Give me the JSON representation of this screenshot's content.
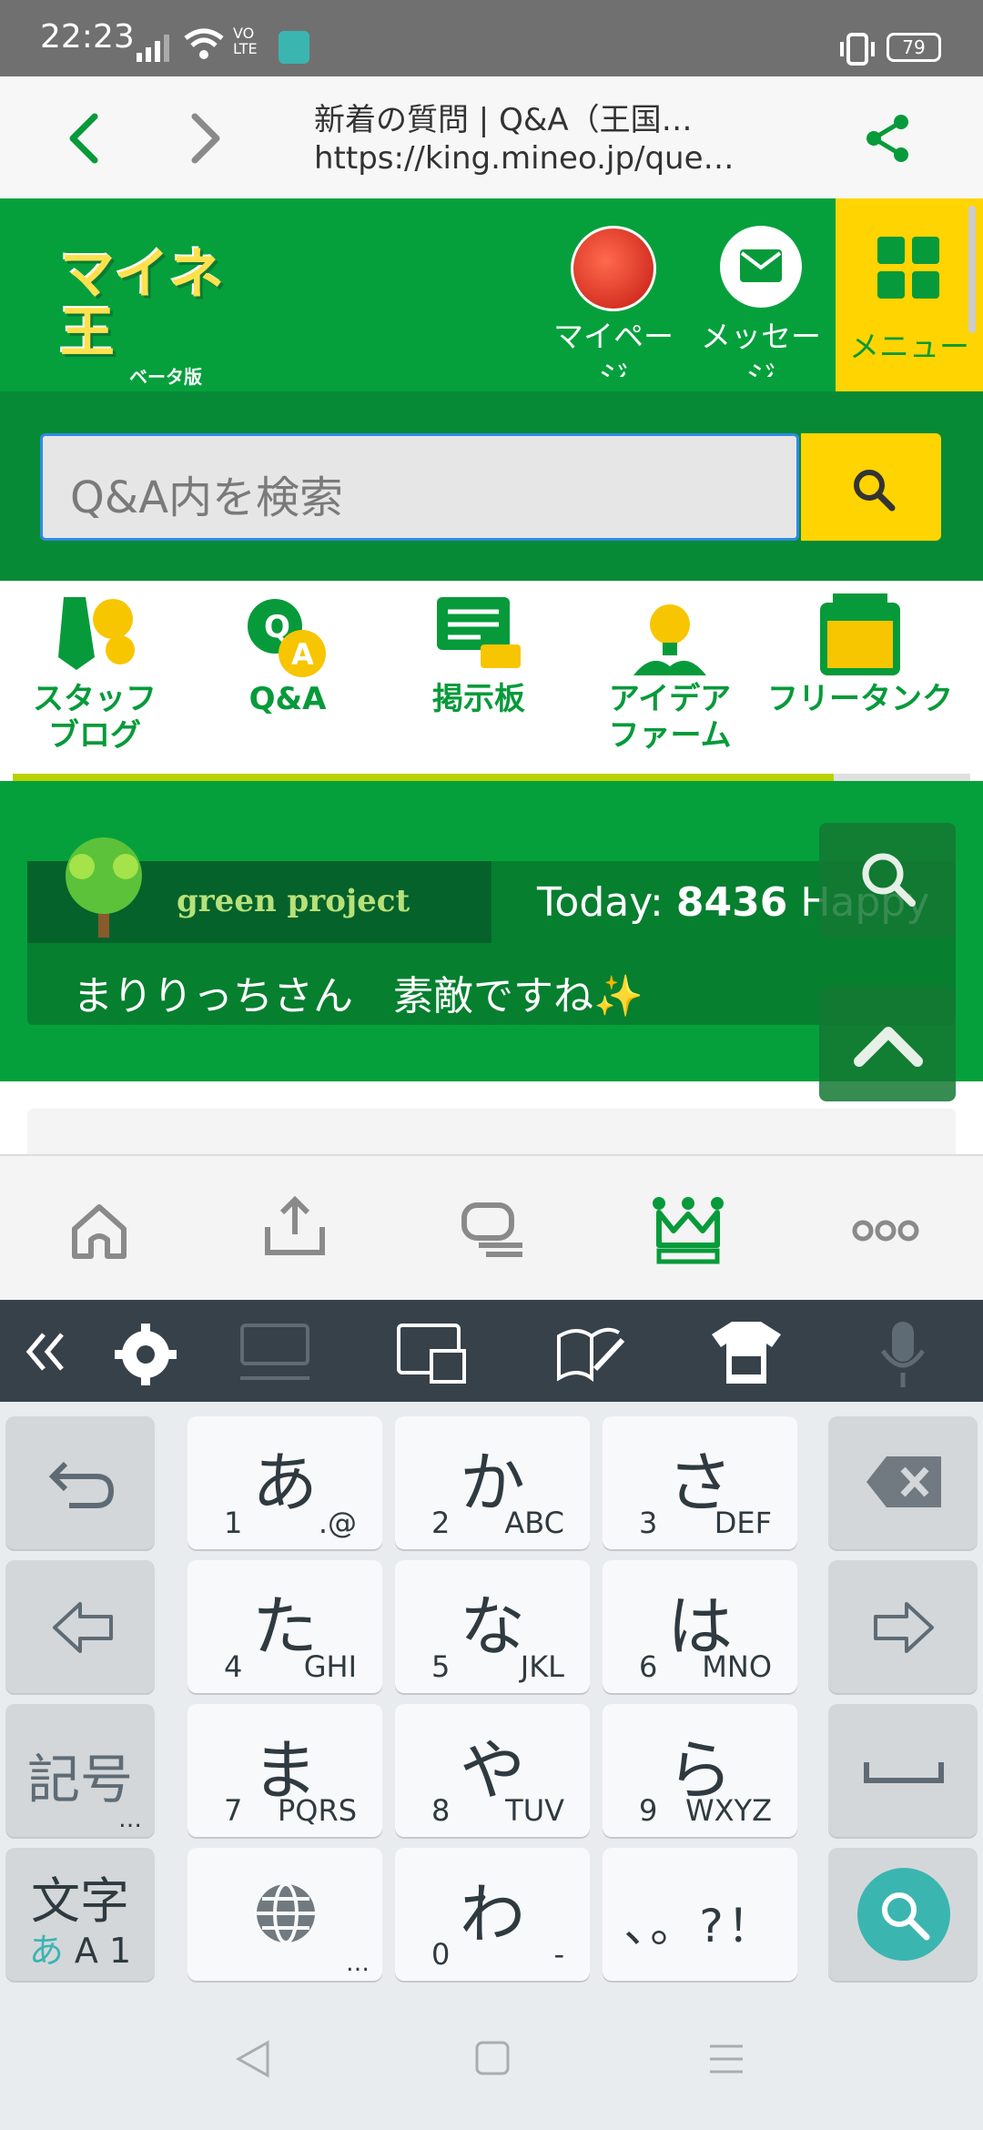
{
  "status_bar": {
    "time": "22:23",
    "battery": "79",
    "network_labels": "VO LTE"
  },
  "browser": {
    "page_title": "新着の質問 | Q&A（王国…",
    "url": "https://king.mineo.jp/que…"
  },
  "site_header": {
    "logo_text": "マイネ王",
    "logo_sub": "ベータ版",
    "mypage_label": "マイペー\nジ",
    "message_label": "メッセー\nジ",
    "menu_label": "メニュー"
  },
  "search": {
    "placeholder": "Q&A内を検索"
  },
  "categories": [
    {
      "label": "スタッフ\nブログ"
    },
    {
      "label": "Q&A"
    },
    {
      "label": "掲示板"
    },
    {
      "label": "アイデア\nファーム"
    },
    {
      "label": "フリータンク"
    }
  ],
  "green_project": {
    "logo_text": "green project",
    "today_prefix": "Today: ",
    "today_count": "8436",
    "today_suffix": " Happy",
    "message": "まりりっちさん　素敵ですね✨"
  },
  "keyboard": {
    "rows": [
      [
        {
          "big": "あ",
          "num": "1",
          "sub": ".@"
        },
        {
          "big": "か",
          "num": "2",
          "sub": "ABC"
        },
        {
          "big": "さ",
          "num": "3",
          "sub": "DEF"
        }
      ],
      [
        {
          "big": "た",
          "num": "4",
          "sub": "GHI"
        },
        {
          "big": "な",
          "num": "5",
          "sub": "JKL"
        },
        {
          "big": "は",
          "num": "6",
          "sub": "MNO"
        }
      ],
      [
        {
          "big": "ま",
          "num": "7",
          "sub": "PQRS"
        },
        {
          "big": "や",
          "num": "8",
          "sub": "TUV"
        },
        {
          "big": "ら",
          "num": "9",
          "sub": "WXYZ"
        }
      ]
    ],
    "symbol_key": "記号",
    "symbol_dots": "…",
    "mode_key_top": "文字",
    "mode_key_bottom_a": "あ",
    "mode_key_bottom_b": "A 1",
    "wa_key": "わ",
    "wa_num": "0",
    "wa_sub": "-",
    "punct_key": "、。?！",
    "globe_dots": "…"
  },
  "colors": {
    "brand_green": "#05a03c",
    "brand_yellow": "#ffd400",
    "keyboard_teal": "#3bb5b0"
  }
}
